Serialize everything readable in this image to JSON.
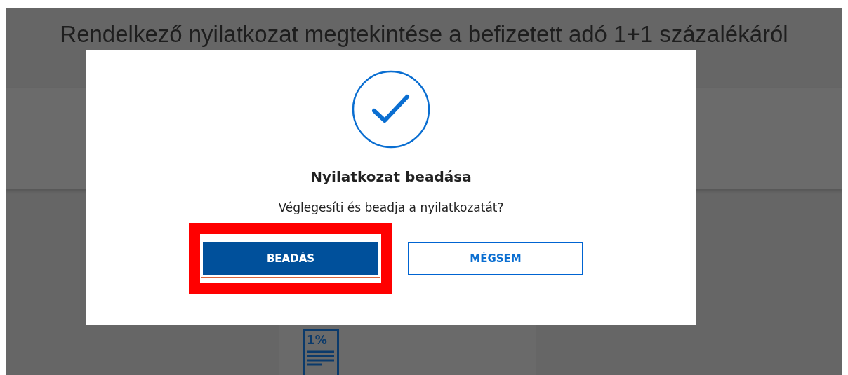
{
  "page": {
    "title": "Rendelkező nyilatkozat megtekintése a befizetett adó 1+1 százalékáról",
    "card_icon_label": "1%"
  },
  "dialog": {
    "title": "Nyilatkozat beadása",
    "message": "Véglegesíti és beadja a nyilatkozatát?",
    "buttons": [
      {
        "label": "BEADÁS",
        "kind": "primary",
        "highlighted": true
      },
      {
        "label": "MÉGSEM",
        "kind": "secondary",
        "highlighted": false
      }
    ]
  }
}
